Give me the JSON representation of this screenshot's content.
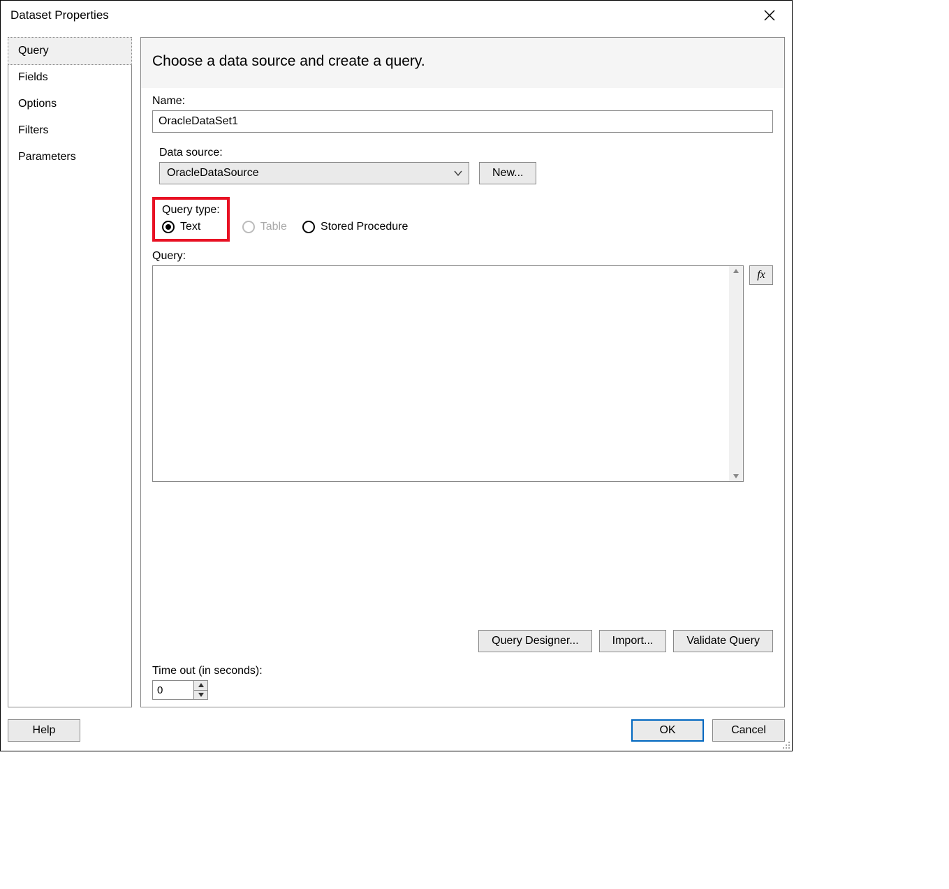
{
  "title": "Dataset Properties",
  "sidebar": {
    "items": [
      {
        "label": "Query",
        "selected": true
      },
      {
        "label": "Fields",
        "selected": false
      },
      {
        "label": "Options",
        "selected": false
      },
      {
        "label": "Filters",
        "selected": false
      },
      {
        "label": "Parameters",
        "selected": false
      }
    ]
  },
  "main": {
    "heading": "Choose a data source and create a query.",
    "name_label": "Name:",
    "name_value": "OracleDataSet1",
    "datasource_label": "Data source:",
    "datasource_value": "OracleDataSource",
    "new_button": "New...",
    "query_type_label": "Query type:",
    "query_type_options": {
      "text": "Text",
      "table": "Table",
      "stored_procedure": "Stored Procedure"
    },
    "query_label": "Query:",
    "query_value": "",
    "fx_label": "fx",
    "query_designer_button": "Query Designer...",
    "import_button": "Import...",
    "validate_query_button": "Validate Query",
    "timeout_label": "Time out (in seconds):",
    "timeout_value": "0"
  },
  "footer": {
    "help": "Help",
    "ok": "OK",
    "cancel": "Cancel"
  }
}
